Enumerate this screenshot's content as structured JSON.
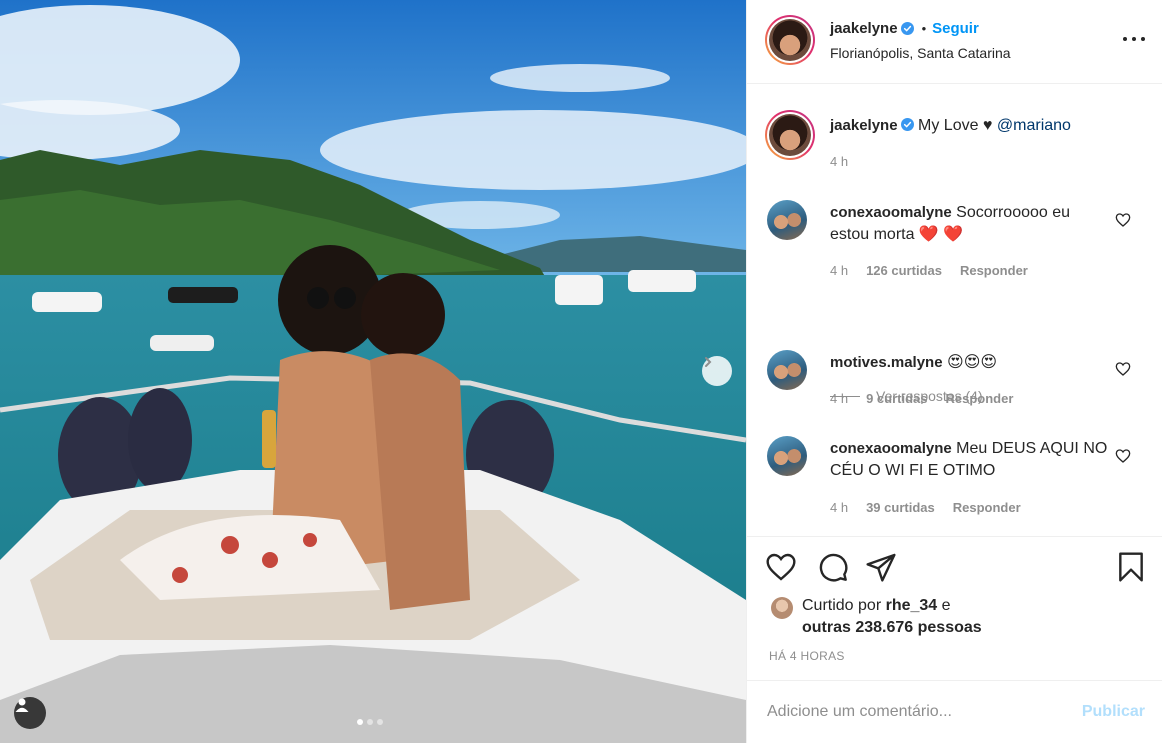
{
  "post": {
    "author": "jaakelyne",
    "follow_label": "Seguir",
    "bullet": "•",
    "location": "Florianópolis, Santa Catarina",
    "caption_text": "My Love ♥",
    "caption_mention": "@mariano",
    "caption_time": "4 h"
  },
  "comments": [
    {
      "user": "conexaoomalyne",
      "text": "Socorrooooo eu estou morta ❤️ ❤️",
      "time": "4 h",
      "likes": "126 curtidas",
      "reply": "Responder"
    },
    {
      "user": "motives.malyne",
      "text": "😍😍😍",
      "time": "4 h",
      "likes": "9 curtidas",
      "reply": "Responder"
    },
    {
      "user": "conexaoomalyne",
      "text": "Meu DEUS AQUI NO CÉU O WI FI E OTIMO",
      "time": "4 h",
      "likes": "39 curtidas",
      "reply": "Responder"
    }
  ],
  "view_replies": "Ver respostas (4)",
  "likes": {
    "prefix": "Curtido por",
    "liker": "rhe_34",
    "conj": "e",
    "others": "outras 238.676 pessoas"
  },
  "timestamp": "HÁ 4 HORAS",
  "comment_box": {
    "placeholder": "Adicione um comentário...",
    "publish_label": "Publicar"
  },
  "carousel": {
    "count": 3,
    "active": 0
  },
  "colors": {
    "accent": "#0095f6",
    "muted": "#8e8e8e",
    "publish_disabled": "#b2dffc",
    "mention": "#00376b"
  },
  "icons": [
    "verified-badge-icon",
    "more-options-icon",
    "heart-icon",
    "comment-icon",
    "share-icon",
    "bookmark-icon",
    "next-arrow-icon",
    "user-tag-icon"
  ]
}
